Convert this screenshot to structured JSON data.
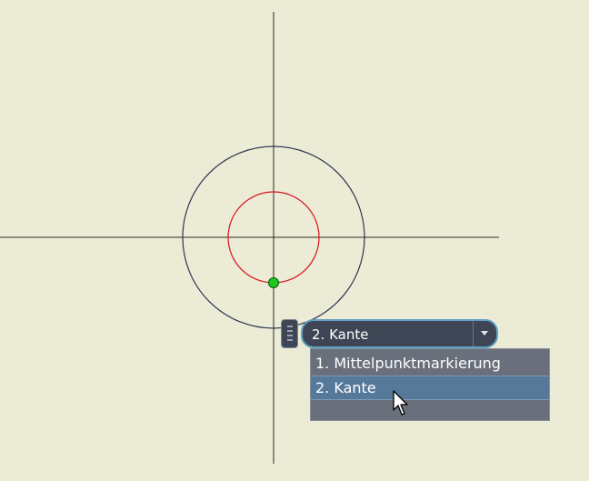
{
  "colors": {
    "background": "#ecebd6",
    "axis_lines": "#2b2b2b",
    "outer_circle": "#2a3650",
    "inner_circle": "#d8141c",
    "center_point": "#1ec81e",
    "combo_background": "#3e4655",
    "combo_border": "#5fa0c4",
    "dropdown_background": "#69707c",
    "dropdown_selected": "#56799a",
    "text": "#ffffff"
  },
  "selector": {
    "current_value": "2. Kante",
    "arrow_icon": "chevron-down-icon",
    "grip_icon": "drag-handle-icon",
    "options": [
      {
        "label": "1. Mittelpunktmarkierung",
        "selected": false
      },
      {
        "label": "2. Kante",
        "selected": true
      }
    ]
  },
  "cursor_icon": "arrow-pointer-icon"
}
